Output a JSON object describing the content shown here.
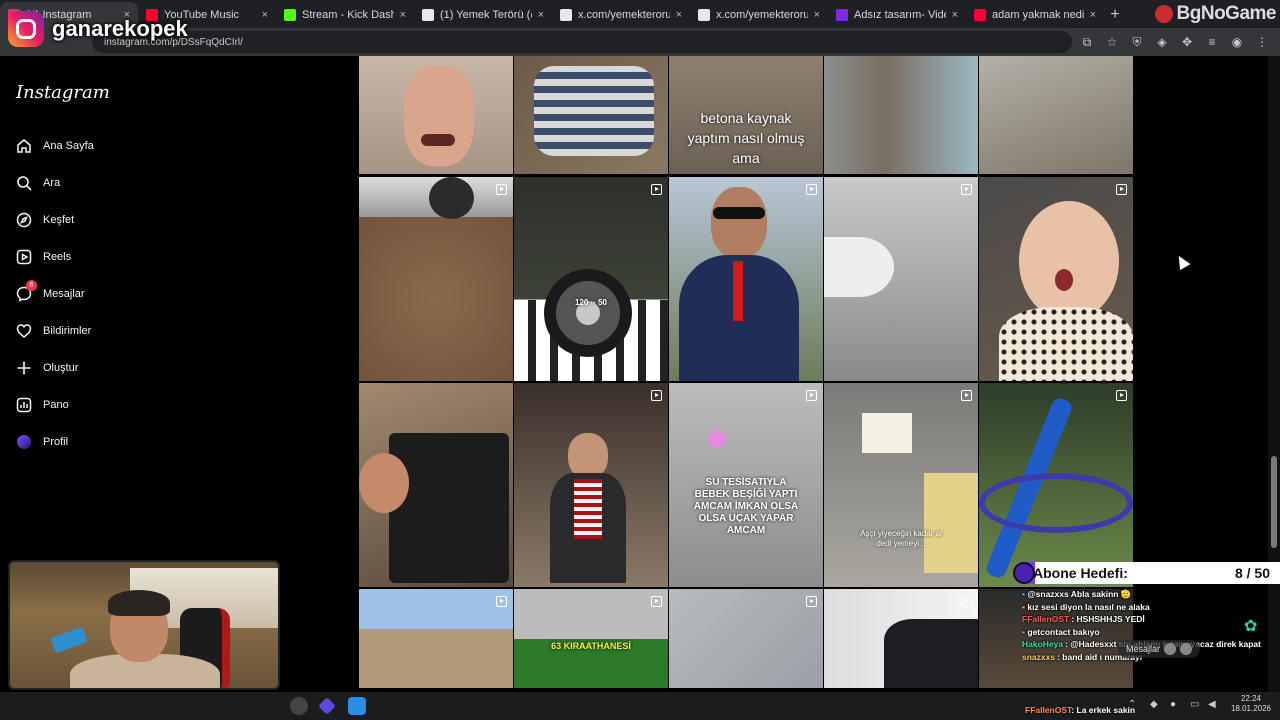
{
  "browser": {
    "tabs": [
      {
        "title": "(4) Instagram",
        "favicon_color": "#e1306c",
        "active": true
      },
      {
        "title": "YouTube Music",
        "favicon_color": "#ff0033",
        "active": false
      },
      {
        "title": "Stream - Kick Dashboard",
        "favicon_color": "#53fc18",
        "active": false
      },
      {
        "title": "(1) Yemek Terörü (@yeme",
        "favicon_color": "#e8e8e8",
        "active": false
      },
      {
        "title": "x.com/yemekteroru_/stat",
        "favicon_color": "#e8e8e8",
        "active": false
      },
      {
        "title": "x.com/yemekteroru_/stat",
        "favicon_color": "#e8e8e8",
        "active": false
      },
      {
        "title": "Adsız tasarım- Video",
        "favicon_color": "#7d2ae8",
        "active": false
      },
      {
        "title": "adam yakmak nedir la",
        "favicon_color": "#ff0033",
        "active": false
      }
    ],
    "close_glyph": "×",
    "new_tab_glyph": "+",
    "url": "instagram.com/p/DSsFqQdCIrl/",
    "corner_brand": "BgNoGame"
  },
  "stream": {
    "channel_name": "ganarekopek",
    "sub_goal_label": "Abone Hedefi:",
    "sub_goal_count": "8 / 50",
    "sub_goal_progress": 0.16,
    "chat": [
      {
        "user": "",
        "user_color": "#6cc3ff",
        "text": "@snazxxs Abla sakinn 🫡"
      },
      {
        "user": "",
        "user_color": "#ffb347",
        "text": "kız sesi diyon la nasıl ne alaka"
      },
      {
        "user": "FFallenOST",
        "user_color": "#ff5a5a",
        "text": "HSHSHHJS YEDİ"
      },
      {
        "user": "",
        "user_color": "#c77dff",
        "text": "getcontact bakıyo"
      },
      {
        "user": "HakoHeya",
        "user_color": "#33e0a0",
        "text": "@Hadesxxt abi ablamı tutamayacaz direk kapat"
      },
      {
        "user": "snazxxs",
        "user_color": "#ffd24d",
        "text": "band aid ı numarayı"
      }
    ],
    "messages_pill": "Mesajlar",
    "tray_message": {
      "user": "FFallenOST",
      "text": "La erkek sakin"
    }
  },
  "instagram": {
    "logo": "Instagram",
    "nav": [
      {
        "id": "home",
        "label": "Ana Sayfa",
        "icon": "home-icon"
      },
      {
        "id": "search",
        "label": "Ara",
        "icon": "search-icon"
      },
      {
        "id": "explore",
        "label": "Keşfet",
        "icon": "compass-icon"
      },
      {
        "id": "reels",
        "label": "Reels",
        "icon": "reels-icon"
      },
      {
        "id": "messages",
        "label": "Mesajlar",
        "icon": "messenger-icon",
        "badge": "6"
      },
      {
        "id": "notifications",
        "label": "Bildirimler",
        "icon": "heart-icon"
      },
      {
        "id": "create",
        "label": "Oluştur",
        "icon": "plus-icon"
      },
      {
        "id": "dashboard",
        "label": "Pano",
        "icon": "chart-icon"
      },
      {
        "id": "profile",
        "label": "Profil",
        "icon": "avatar-icon"
      }
    ],
    "grid_captions": {
      "r0c2": "betona kaynak\nyaptım nasıl olmuş\nama",
      "r1c1": "120 ·· 50",
      "r2c2": "SU TESİSATIYLA\nBEBEK BEŞİĞİ YAPTI\nAMCAM İMKAN OLSA\nOLSA UÇAK YAPAR\nAMCAM",
      "r2c3": "Aşçı yiyeceğin kadar al\ndedi yemeyi...",
      "r3c1": "63 KIRAATHANESİ"
    }
  },
  "taskbar": {
    "time": "22:24",
    "date": "18.01.2026"
  }
}
